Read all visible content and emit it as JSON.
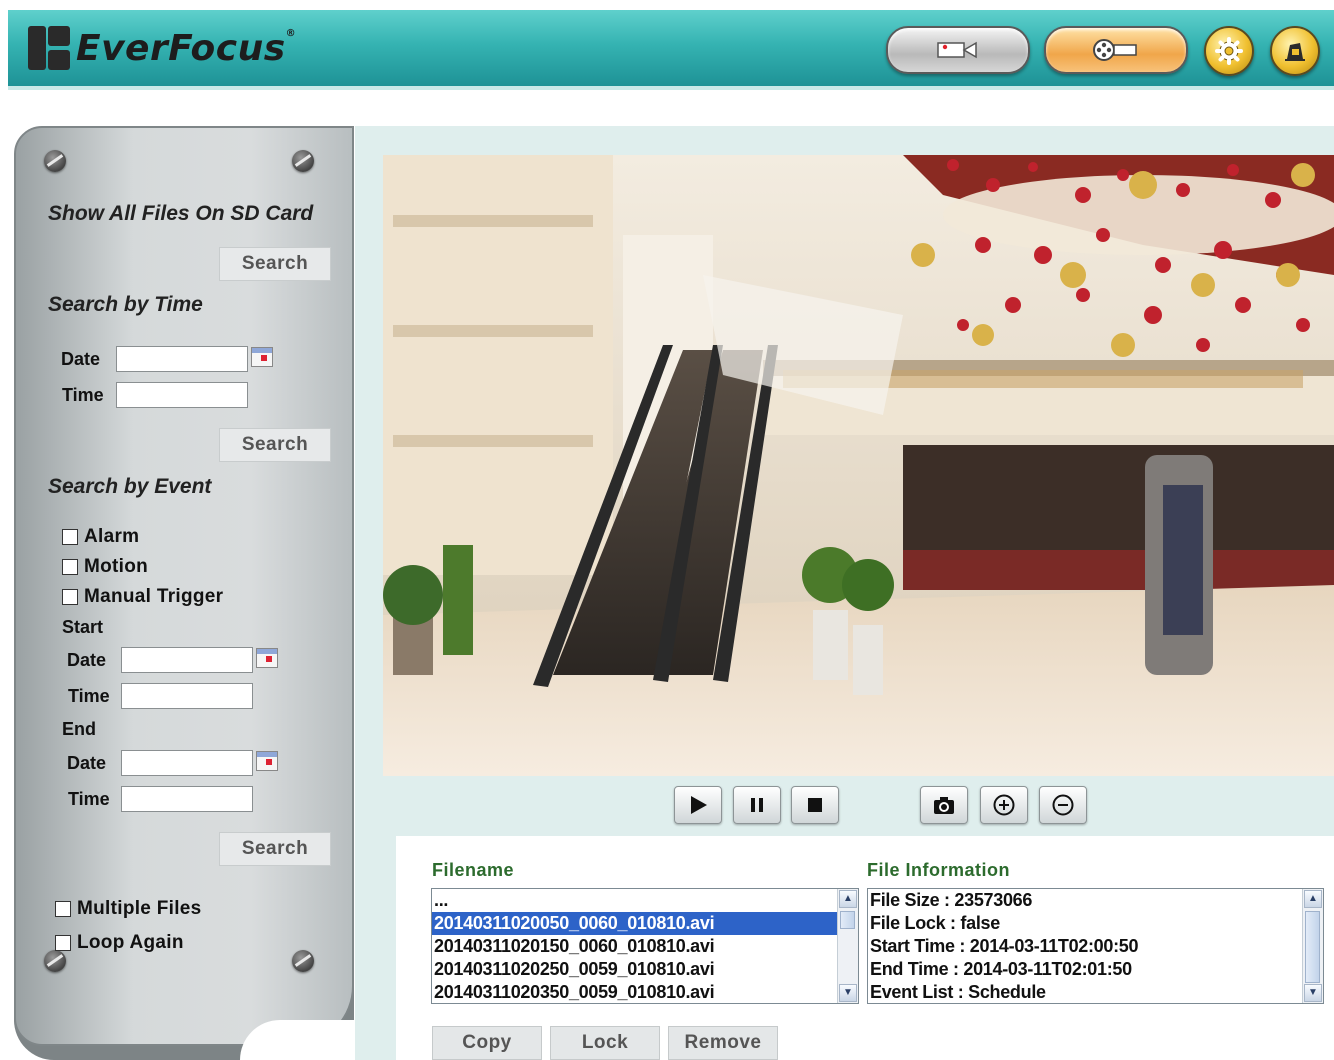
{
  "brand": {
    "name": "EverFocus",
    "trademark": "®"
  },
  "header": {
    "live_button_icon": "video-camera-icon",
    "playback_button_icon": "film-reel-icon",
    "settings_icon": "gear-icon",
    "logout_icon": "logout-icon"
  },
  "sidebar": {
    "show_all": {
      "title": "Show All Files On SD Card",
      "search_label": "Search"
    },
    "by_time": {
      "title": "Search by Time",
      "date_label": "Date",
      "date_value": "",
      "time_label": "Time",
      "time_value": "",
      "search_label": "Search"
    },
    "by_event": {
      "title": "Search by Event",
      "checkboxes": [
        {
          "label": "Alarm",
          "checked": false
        },
        {
          "label": "Motion",
          "checked": false
        },
        {
          "label": "Manual Trigger",
          "checked": false
        }
      ],
      "start_label": "Start",
      "start_date_label": "Date",
      "start_date_value": "",
      "start_time_label": "Time",
      "start_time_value": "",
      "end_label": "End",
      "end_date_label": "Date",
      "end_date_value": "",
      "end_time_label": "Time",
      "end_time_value": "",
      "search_label": "Search"
    },
    "options": [
      {
        "label": "Multiple Files",
        "checked": false
      },
      {
        "label": "Loop Again",
        "checked": false
      }
    ]
  },
  "player": {
    "controls": [
      "play-icon",
      "pause-icon",
      "stop-icon",
      "snapshot-icon",
      "zoom-in-icon",
      "zoom-out-icon"
    ]
  },
  "files": {
    "filename_title": "Filename",
    "info_title": "File Information",
    "list": [
      "...",
      "20140311020050_0060_010810.avi",
      "20140311020150_0060_010810.avi",
      "20140311020250_0059_010810.avi",
      "20140311020350_0059_010810.avi"
    ],
    "selected_index": 1,
    "info": [
      "File Size : 23573066",
      "File Lock : false",
      "Start Time : 2014-03-11T02:00:50",
      "End Time : 2014-03-11T02:01:50",
      "Event List : Schedule"
    ],
    "actions": {
      "copy": "Copy",
      "lock": "Lock",
      "remove": "Remove"
    }
  },
  "colors": {
    "header_teal": "#35b3b2",
    "title_green": "#2c6b2d",
    "selection_blue": "#2d63c8",
    "panel_bg": "#dfeeed"
  }
}
